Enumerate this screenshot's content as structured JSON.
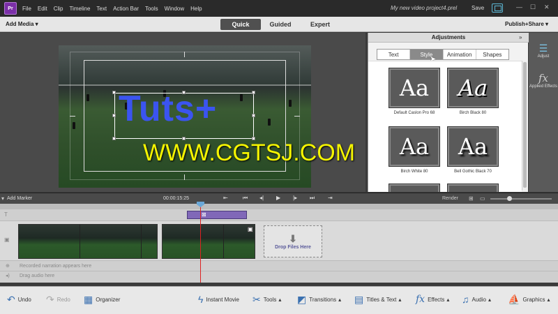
{
  "menubar": {
    "logo": "Pr",
    "items": [
      "File",
      "Edit",
      "Clip",
      "Timeline",
      "Text",
      "Action Bar",
      "Tools",
      "Window",
      "Help"
    ],
    "project_name": "My new video project4.prel",
    "save_label": "Save"
  },
  "modebar": {
    "add_media": "Add Media ▾",
    "tabs": [
      "Quick",
      "Guided",
      "Expert"
    ],
    "active_tab": "Quick",
    "publish": "Publish+Share ▾"
  },
  "monitor": {
    "title_text": "Tuts+",
    "watermark": "WWW.CGTSJ.COM"
  },
  "adjustments": {
    "title": "Adjustments",
    "tabs": [
      "Text",
      "Style",
      "Animation",
      "Shapes"
    ],
    "active_tab": "Style",
    "styles": [
      {
        "label": "Default Caslon Pro 68",
        "glyph": "Aa"
      },
      {
        "label": "Birch Black 80",
        "glyph": "Aa"
      },
      {
        "label": "Birch White 80",
        "glyph": "Aa"
      },
      {
        "label": "Bell Gothic Black 70",
        "glyph": "Aa"
      }
    ]
  },
  "rail": {
    "adjust_label": "Adjust",
    "effects_label": "Applied Effects"
  },
  "timeline": {
    "add_marker": "Add Marker",
    "timecode": "00:00:15:25",
    "render": "Render",
    "drop_files": "Drop Files Here",
    "narration_hint": "Recorded narration appears here",
    "audio_hint": "Drag audio here"
  },
  "bottombar": {
    "undo": "Undo",
    "redo": "Redo",
    "organizer": "Organizer",
    "instant_movie": "Instant Movie",
    "tools": "Tools",
    "transitions": "Transitions",
    "titles": "Titles & Text",
    "effects": "Effects",
    "audio": "Audio",
    "graphics": "Graphics"
  },
  "colors": {
    "accent": "#7b2fa8",
    "title_blue": "#3b54f0",
    "watermark_yellow": "#f5f500",
    "playhead": "#d22222"
  }
}
